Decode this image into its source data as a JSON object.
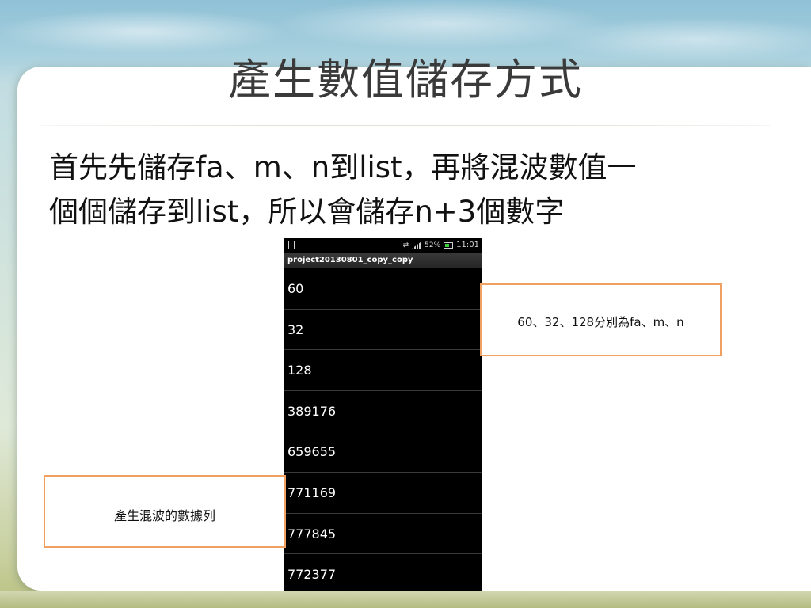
{
  "slide": {
    "title": "產生數值儲存方式",
    "body_line1": "首先先儲存fa、m、n到list，再將混波數值一",
    "body_line2": "個個儲存到list，所以會儲存n+3個數字"
  },
  "phone": {
    "status": {
      "battery_percent": "52%",
      "time": "11:01"
    },
    "app_title": "project20130801_copy_copy",
    "items": [
      "60",
      "32",
      "128",
      "389176",
      "659655",
      "771169",
      "777845",
      "772377"
    ]
  },
  "callouts": {
    "right_text": "60、32、128分別為fa、m、n",
    "left_text": "產生混波的數據列"
  },
  "colors": {
    "callout_border": "#f0a060",
    "phone_background": "#000000"
  }
}
